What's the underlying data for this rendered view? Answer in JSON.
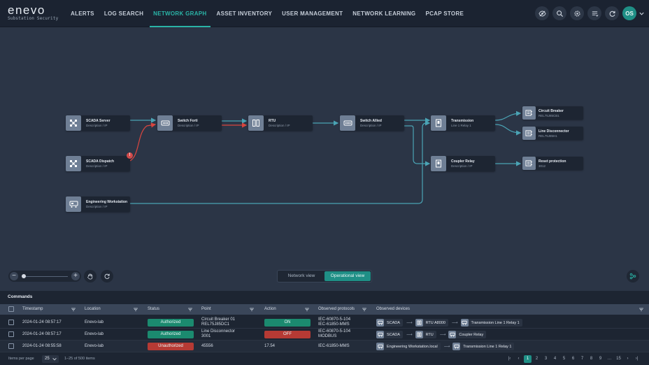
{
  "brand": {
    "name": "enevo",
    "subtitle": "Substation Security"
  },
  "nav": [
    {
      "label": "ALERTS",
      "active": false
    },
    {
      "label": "LOG SEARCH",
      "active": false
    },
    {
      "label": "NETWORK GRAPH",
      "active": true
    },
    {
      "label": "ASSET INVENTORY",
      "active": false
    },
    {
      "label": "USER MANAGEMENT",
      "active": false
    },
    {
      "label": "NETWORK LEARNING",
      "active": false
    },
    {
      "label": "PCAP STORE",
      "active": false
    }
  ],
  "topbar_icons": [
    "eye-off-icon",
    "search-icon",
    "gear-icon",
    "list-icon",
    "refresh-icon"
  ],
  "user": {
    "initials": "OS"
  },
  "graph": {
    "nodes": [
      {
        "id": "scada-server",
        "title": "SCADA Server",
        "sub": "Description / IP",
        "icon": "network-icon"
      },
      {
        "id": "scada-dispatch",
        "title": "SCADA Dispatch",
        "sub": "Description / IP",
        "icon": "network-icon",
        "alert": "!"
      },
      {
        "id": "eng-ws",
        "title": "Engineering Workstation",
        "sub": "Description / IP",
        "icon": "workstation-icon"
      },
      {
        "id": "switch-forti",
        "title": "Switch Forti",
        "sub": "Description / IP",
        "icon": "switch-icon"
      },
      {
        "id": "rtu",
        "title": "RTU",
        "sub": "Description / IP",
        "icon": "rtu-icon"
      },
      {
        "id": "switch-allied",
        "title": "Switch Allied",
        "sub": "Description / IP",
        "icon": "switch-icon"
      },
      {
        "id": "transmission",
        "title": "Transmission",
        "sub": "Line 1 Relay 1",
        "icon": "relay-icon"
      },
      {
        "id": "coupler-relay",
        "title": "Coupler Relay",
        "sub": "Description / IP",
        "icon": "relay-icon"
      },
      {
        "id": "circuit-breaker",
        "title": "Circuit Breaker",
        "sub": "REL75J85CB1",
        "icon": "breaker-icon"
      },
      {
        "id": "line-disconnector",
        "title": "Line Disconnector",
        "sub": "REL75J85H1",
        "icon": "breaker-icon"
      },
      {
        "id": "reset-protection",
        "title": "Reset protection",
        "sub": "3012",
        "icon": "breaker-icon"
      }
    ],
    "link_colors": {
      "normal": "#4aa3b4",
      "alert": "#d9463f"
    }
  },
  "controls": {
    "zoom_minus": "−",
    "zoom_plus": "+",
    "zoom_level": 0.05
  },
  "view_toggle": {
    "network": "Network view",
    "operational": "Operational view",
    "active": "operational"
  },
  "commands": {
    "title": "Commands",
    "columns": [
      "Timestamp",
      "Location",
      "Status",
      "Point",
      "Action",
      "Observed protocols",
      "Observed devices"
    ],
    "rows": [
      {
        "timestamp": "2024-01-24 08:57:17",
        "location": "Enevo-lab",
        "status": "Authorized",
        "status_kind": "green",
        "point": [
          "Circuit Breaker 01",
          "REL75J85DC1"
        ],
        "action": "ON",
        "action_kind": "on",
        "protocols": [
          "IEC-60870-5-104",
          "IEC-61850-MMS"
        ],
        "devices": [
          "SCADA",
          "RTU A8000",
          "Transmission Line 1 Relay 1"
        ]
      },
      {
        "timestamp": "2024-01-24 08:57:17",
        "location": "Enevo-lab",
        "status": "Authorized",
        "status_kind": "green",
        "point": [
          "Line Disconnector",
          "3001"
        ],
        "action": "OFF",
        "action_kind": "off",
        "protocols": [
          "IEC-60870-5-104",
          "MODBUS"
        ],
        "devices": [
          "SCADA",
          "RTU",
          "Coupler Relay"
        ]
      },
      {
        "timestamp": "2024-01-24 08:55:58",
        "location": "Enevo-lab",
        "status": "Unauthorized",
        "status_kind": "red",
        "point": [
          "45556"
        ],
        "action": "17.54",
        "action_kind": "text",
        "protocols": [
          "IEC-61850-MMS"
        ],
        "devices": [
          "Engineering Workstation.local",
          "Transmission Line 1 Relay 1"
        ]
      }
    ]
  },
  "footer": {
    "items_per_page_label": "Items per page",
    "items_per_page": "25",
    "range": "1–25 of 500 items",
    "pages": [
      "1",
      "2",
      "3",
      "4",
      "5",
      "6",
      "7",
      "8",
      "9",
      "…",
      "15"
    ],
    "current_page": "1"
  }
}
